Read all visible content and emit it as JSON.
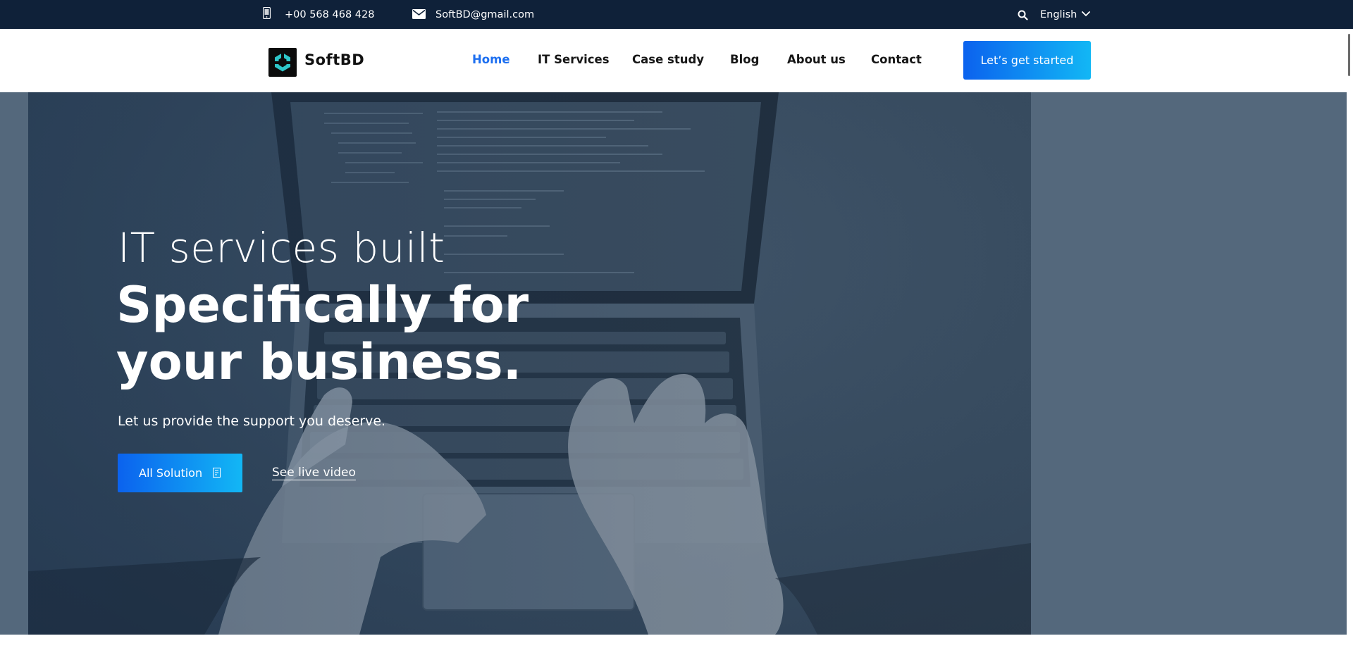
{
  "topbar": {
    "phone": "+00 568 468 428",
    "email": "SoftBD@gmail.com",
    "language": "English"
  },
  "header": {
    "logo_text": "SoftBD",
    "nav": [
      {
        "label": "Home",
        "active": true
      },
      {
        "label": "IT Services",
        "active": false
      },
      {
        "label": "Case study",
        "active": false
      },
      {
        "label": "Blog",
        "active": false
      },
      {
        "label": "About us",
        "active": false
      },
      {
        "label": "Contact",
        "active": false
      }
    ],
    "cta_label": "Let’s get started"
  },
  "hero": {
    "line1": "IT services built",
    "line2": "Specifically for",
    "line3": "your business.",
    "subtitle": "Let us provide the support you deserve.",
    "primary_button": "All Solution",
    "secondary_link": "See live video"
  },
  "colors": {
    "topbar_bg": "#0f2139",
    "accent": "#1d6ff0",
    "button_gradient_start": "#0b62ee",
    "button_gradient_end": "#12b7f5",
    "hero_bg": "#54687c"
  },
  "icons": {
    "phone": "phone-icon",
    "mail": "mail-icon",
    "search": "search-icon",
    "language_dropdown": "chevron-down-icon",
    "button": "arrow-icon"
  }
}
